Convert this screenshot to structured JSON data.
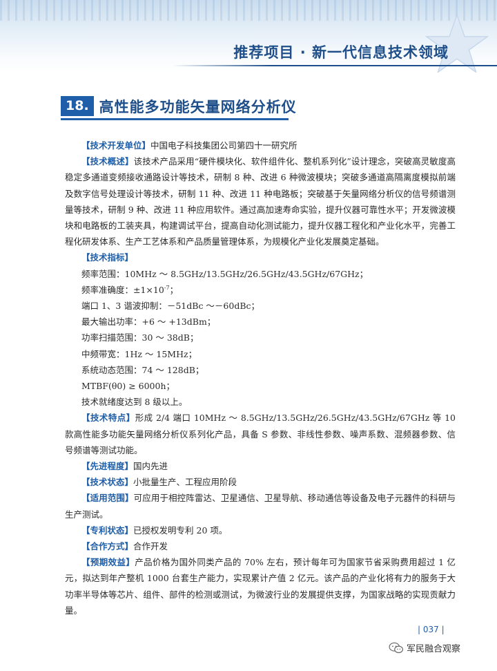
{
  "header": {
    "title": "推荐项目 · 新一代信息技术领域"
  },
  "section": {
    "number": "18.",
    "title": "高性能多功能矢量网络分析仪"
  },
  "unit": {
    "label": "【技术开发单位】",
    "text": "中国电子科技集团公司第四十一研究所"
  },
  "overview": {
    "label": "【技术概述】",
    "text": "该技术产品采用“硬件模块化、软件组件化、整机系列化”设计理念，突破高灵敏度高稳定多通道变频接收通路设计等技术，研制 8 种、改进 6 种微波模块；突破多通道高隔离度模拟前端及数字信号处理设计等技术，研制 11 种、改进 11 种电路板；突破基于矢量网络分析仪的信号频谱测量等技术，研制 9 种、改进 11 种应用软件。通过高加速寿命实验，提升仪器可靠性水平；开发微波模块和电路板的工装夹具，构建调试平台，提高自动化测试能力，提升仪器工程化和产业化水平，完善工程化研发体系、生产工艺体系和产品质量管理体系，为规模化产业化发展奠定基础。"
  },
  "specs": {
    "label": "【技术指标】",
    "freq_range": "频率范围：10MHz ～ 8.5GHz/13.5GHz/26.5GHz/43.5GHz/67GHz；",
    "freq_accuracy_pre": "频率准确度：±1×10",
    "freq_accuracy_exp": "-7",
    "freq_accuracy_post": "；",
    "harmonic": "端口 1、3 谐波抑制：－51dBc ～－60dBc；",
    "max_power": "最大输出功率：+6 ～ +13dBm；",
    "power_sweep": "功率扫描范围：30 ～ 38dB；",
    "if_bandwidth": "中频带宽：1Hz ～ 15MHz；",
    "dynamic_range": "系统动态范围：74 ～ 128dB；",
    "mtbf": "MTBF(θ0) ≥ 6000h；",
    "readiness": "技术就绪度达到 8 级以上。"
  },
  "features": {
    "label": "【技术特点】",
    "text": "形成 2/4 端口 10MHz ～ 8.5GHz/13.5GHz/26.5GHz/43.5GHz/67GHz 等 10 款高性能多功能矢量网络分析仪系列化产品，具备 S 参数、非线性参数、噪声系数、混频器参数、信号频谱等测试功能。"
  },
  "advancement": {
    "label": "【先进程度】",
    "text": "国内先进"
  },
  "status": {
    "label": "【技术状态】",
    "text": "小批量生产、工程应用阶段"
  },
  "scope": {
    "label": "【适用范围】",
    "text": "可应用于相控阵雷达、卫星通信、卫星导航、移动通信等设备及电子元器件的科研与生产测试。"
  },
  "patent": {
    "label": "【专利状态】",
    "text": "已授权发明专利 20 项。"
  },
  "cooperation": {
    "label": "【合作方式】",
    "text": "合作开发"
  },
  "benefit": {
    "label": "【预期效益】",
    "text": "产品价格为国外同类产品的 70% 左右，预计每年可为国家节省采购费用超过 1 亿元，拟达到年产整机 1000 台套生产能力，实现累计产值 2 亿元。该产品的产业化将有力的服务于大功率半导体等芯片、组件、部件的检测或测试，为微波行业的发展提供支撑，为国家战略的实现贡献力量。"
  },
  "footer": {
    "page_number": "| 037 |",
    "watermark": "军民融合观察"
  }
}
